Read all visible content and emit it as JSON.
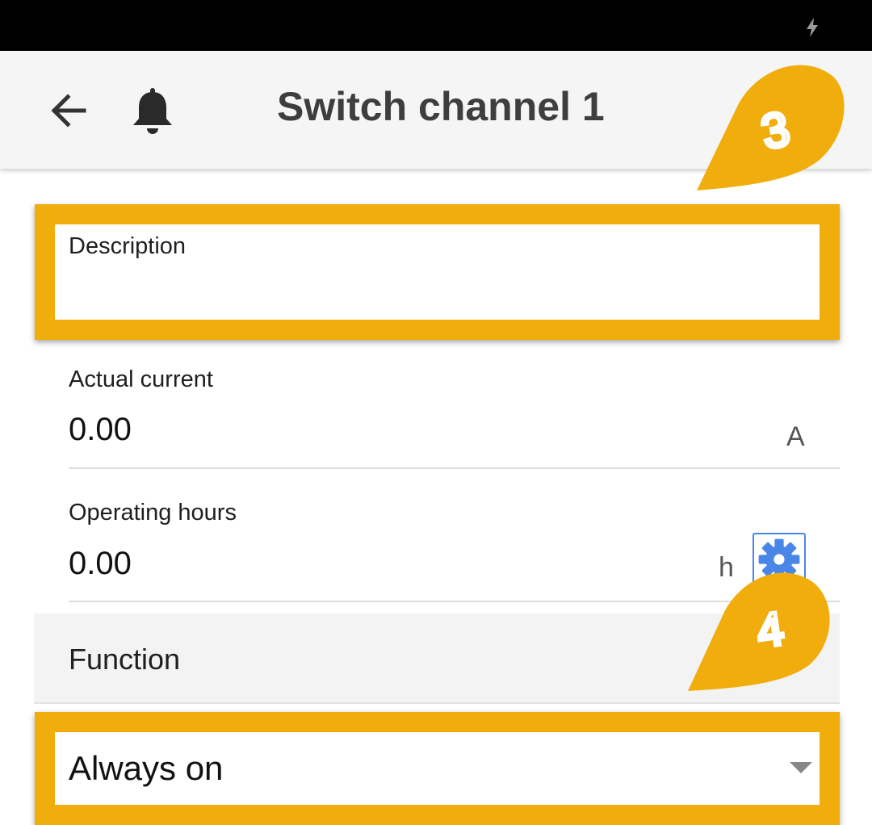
{
  "header": {
    "title": "Switch channel 1",
    "back_icon": "arrow-left-icon",
    "notification_icon": "bell-icon"
  },
  "status_bar": {
    "charging_icon": "bolt-icon"
  },
  "form": {
    "description": {
      "label": "Description",
      "value": ""
    },
    "actual_current": {
      "label": "Actual current",
      "value": "0.00",
      "unit": "A"
    },
    "operating_hours": {
      "label": "Operating hours",
      "value": "0.00",
      "unit": "h",
      "settings_icon": "gear-icon"
    },
    "function_section": {
      "label": "Function"
    },
    "function_select": {
      "selected": "Always on"
    }
  },
  "annotations": {
    "callout_3": "3",
    "callout_4": "4",
    "accent_color": "#f0ad0c",
    "link_color": "#4a86e8"
  }
}
